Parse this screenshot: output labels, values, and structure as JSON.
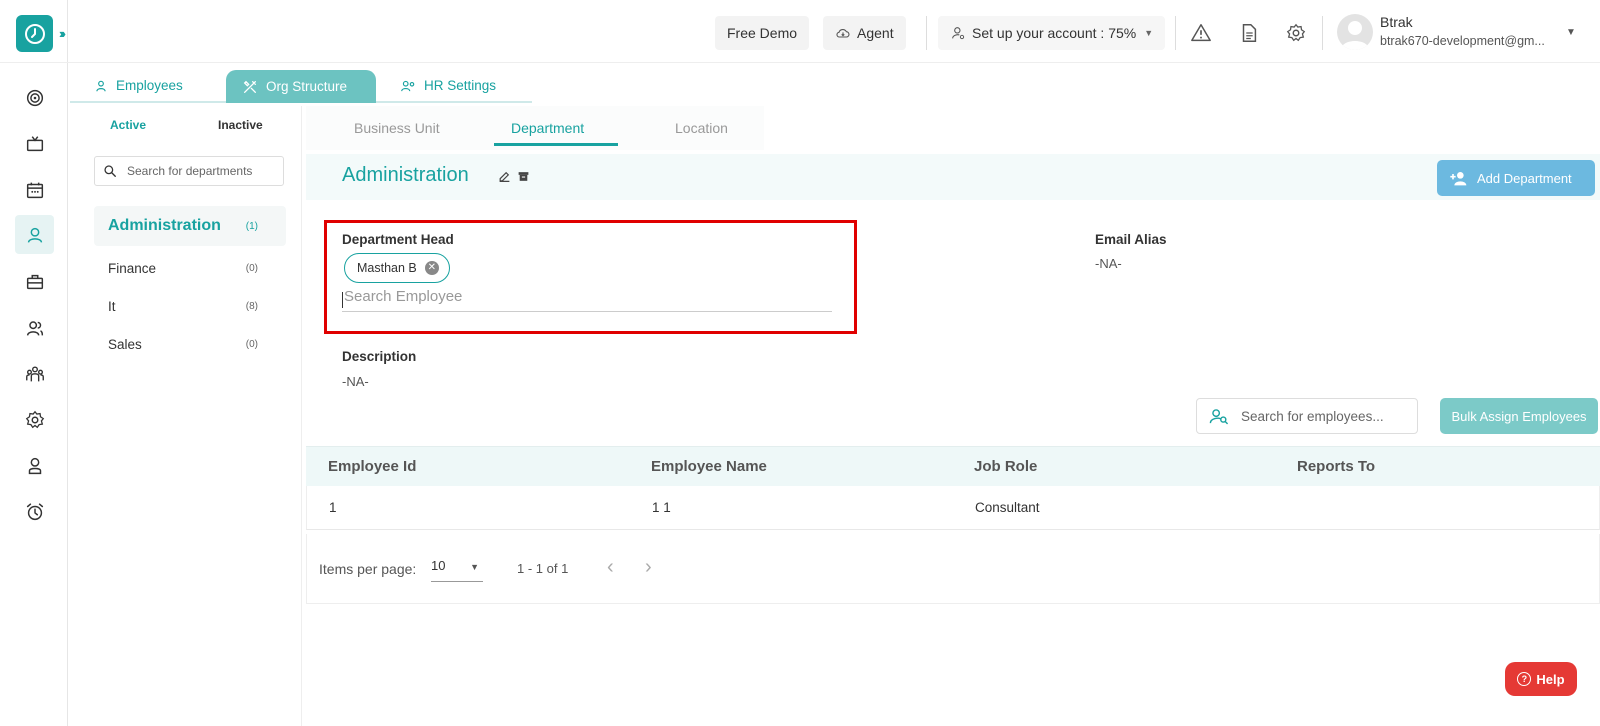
{
  "topbar": {
    "free_demo": "Free Demo",
    "agent": "Agent",
    "setup_account": "Set up your account : 75%",
    "user_name": "Btrak",
    "user_email": "btrak670-development@gm..."
  },
  "main_tabs": [
    {
      "label": "Employees"
    },
    {
      "label": "Org Structure"
    },
    {
      "label": "HR Settings"
    }
  ],
  "status_tabs": {
    "active": "Active",
    "inactive": "Inactive"
  },
  "dept_search_placeholder": "Search for departments",
  "departments": [
    {
      "name": "Administration",
      "count": "(1)"
    },
    {
      "name": "Finance",
      "count": "(0)"
    },
    {
      "name": "It",
      "count": "(8)"
    },
    {
      "name": "Sales",
      "count": "(0)"
    }
  ],
  "dept_tabs": [
    "Business Unit",
    "Department",
    "Location"
  ],
  "selected": {
    "title": "Administration",
    "add_button": "Add Department",
    "department_head_label": "Department Head",
    "department_head_chip": "Masthan B",
    "employee_search_placeholder": "Search Employee",
    "email_alias_label": "Email Alias",
    "email_alias_value": "-NA-",
    "description_label": "Description",
    "description_value": "-NA-"
  },
  "employee_filter_placeholder": "Search for employees...",
  "bulk_assign": "Bulk Assign Employees",
  "table": {
    "columns": [
      "Employee Id",
      "Employee Name",
      "Job Role",
      "Reports To"
    ],
    "rows": [
      [
        "1",
        "1 1",
        "Consultant",
        ""
      ]
    ]
  },
  "paginator": {
    "label": "Items per page:",
    "page_size": "10",
    "range": "1 - 1 of 1"
  },
  "help": "Help",
  "colors": {
    "accent": "#18a2a0",
    "highlight": "#e00000",
    "help": "#e53935"
  }
}
